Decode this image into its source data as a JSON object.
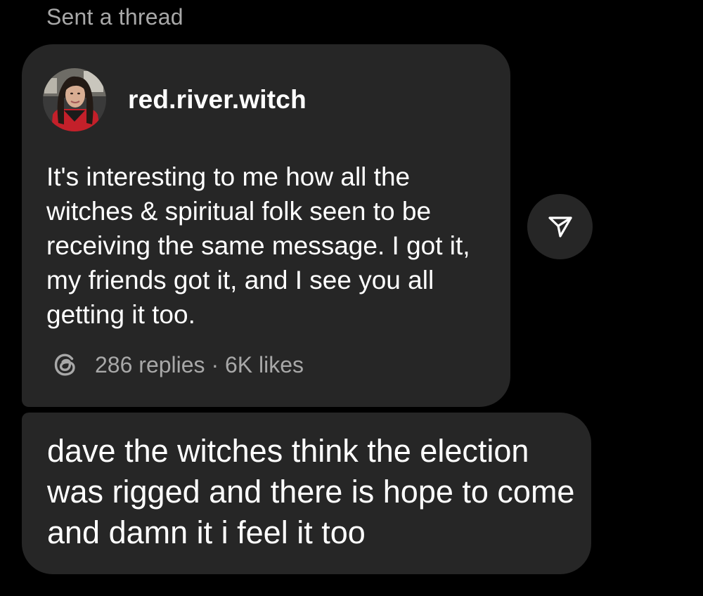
{
  "header": {
    "sent_label": "Sent a thread"
  },
  "thread_card": {
    "author": "red.river.witch",
    "avatar_icon": "user-avatar-photo",
    "text": "It's interesting to me how all the witches & spiritual folk seen to be receiving the same message. I got it, my friends got it, and I see you all getting it too.",
    "meta": "286 replies · 6K likes",
    "meta_icon": "threads-logo-icon",
    "share_icon": "send-arrow-icon"
  },
  "reply_message": {
    "text": "dave the witches think the election was rigged and there is hope to come and damn it i feel it too"
  },
  "colors": {
    "background": "#000000",
    "bubble": "#262626",
    "primary_text": "#ffffff",
    "secondary_text": "#a8a8a8"
  }
}
